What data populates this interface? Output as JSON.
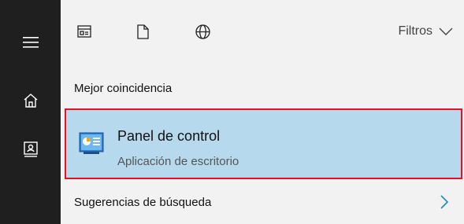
{
  "toolbar": {
    "filters_label": "Filtros"
  },
  "sections": {
    "best_match_title": "Mejor coincidencia",
    "suggestions_title": "Sugerencias de búsqueda"
  },
  "best_match": {
    "title": "Panel de control",
    "subtitle": "Aplicación de escritorio"
  },
  "colors": {
    "sidebar": "#1f1f1f",
    "panel": "#f2f2f2",
    "selection": "#b7d9ee",
    "highlight_border": "#e81123",
    "chevron": "#1e88c7"
  },
  "icons": {
    "sidebar": [
      "hamburger-menu-icon",
      "home-icon",
      "notebook-icon"
    ],
    "toolbar": [
      "apps-icon",
      "document-icon",
      "web-globe-icon"
    ],
    "filters": "chevron-down-icon",
    "result": "control-panel-icon",
    "suggestions": "chevron-right-icon"
  }
}
